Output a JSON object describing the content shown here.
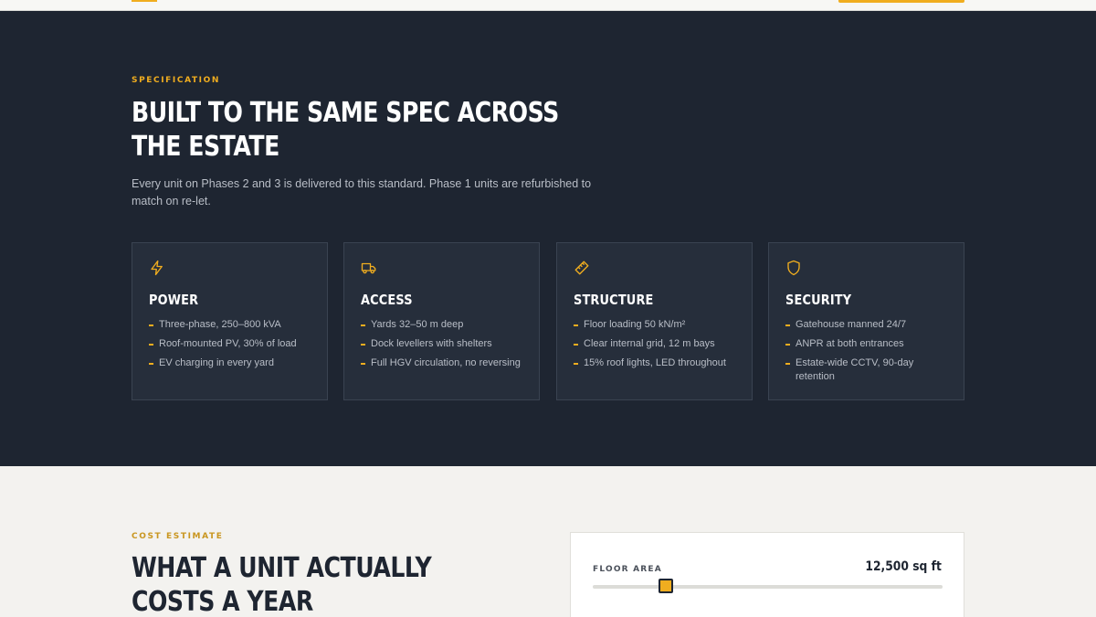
{
  "spec": {
    "eyebrow": "SPECIFICATION",
    "title": "BUILT TO THE SAME SPEC ACROSS THE ESTATE",
    "lead": "Every unit on Phases 2 and 3 is delivered to this standard. Phase 1 units are refurbished to match on re-let.",
    "cards": [
      {
        "icon": "lightning-icon",
        "title": "POWER",
        "items": [
          "Three-phase, 250–800 kVA",
          "Roof-mounted PV, 30% of load",
          "EV charging in every yard"
        ]
      },
      {
        "icon": "truck-icon",
        "title": "ACCESS",
        "items": [
          "Yards 32–50 m deep",
          "Dock levellers with shelters",
          "Full HGV circulation, no reversing"
        ]
      },
      {
        "icon": "ruler-icon",
        "title": "STRUCTURE",
        "items": [
          "Floor loading 50 kN/m²",
          "Clear internal grid, 12 m bays",
          "15% roof lights, LED throughout"
        ]
      },
      {
        "icon": "shield-icon",
        "title": "SECURITY",
        "items": [
          "Gatehouse manned 24/7",
          "ANPR at both entrances",
          "Estate-wide CCTV, 90-day retention"
        ]
      }
    ]
  },
  "cost": {
    "eyebrow": "COST ESTIMATE",
    "title": "WHAT A UNIT ACTUALLY COSTS A YEAR",
    "floor_area": {
      "label": "FLOOR AREA",
      "value_text": "12,500 sq ft",
      "slider_fraction": 0.21
    }
  },
  "colors": {
    "accent": "#f0ad1f",
    "dark": "#1e2531",
    "card": "#262e3b"
  }
}
